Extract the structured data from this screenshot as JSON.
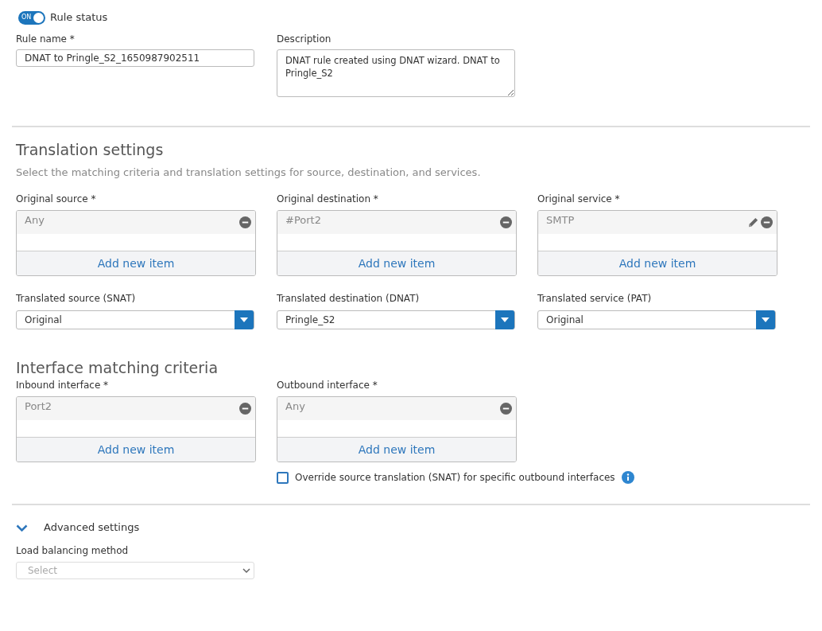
{
  "rule_status": {
    "label": "Rule status",
    "toggle_text": "ON",
    "on": true
  },
  "rule_name": {
    "label": "Rule name *",
    "value": "DNAT to Pringle_S2_1650987902511"
  },
  "description": {
    "label": "Description",
    "value": "DNAT rule created using DNAT wizard. DNAT to Pringle_S2"
  },
  "translation_settings": {
    "title": "Translation settings",
    "subtitle": "Select the matching criteria and translation settings for source, destination, and services.",
    "lists": [
      {
        "label": "Original source *",
        "items": [
          {
            "text": "Any",
            "editable": false
          }
        ],
        "add_label": "Add new item"
      },
      {
        "label": "Original destination *",
        "items": [
          {
            "text": "#Port2",
            "editable": false
          }
        ],
        "add_label": "Add new item"
      },
      {
        "label": "Original service *",
        "items": [
          {
            "text": "SMTP",
            "editable": true
          }
        ],
        "add_label": "Add new item"
      }
    ],
    "selects": [
      {
        "label": "Translated source (SNAT)",
        "value": "Original"
      },
      {
        "label": "Translated destination (DNAT)",
        "value": "Pringle_S2"
      },
      {
        "label": "Translated service (PAT)",
        "value": "Original"
      }
    ]
  },
  "interface_matching": {
    "title": "Interface matching criteria",
    "lists": [
      {
        "label": "Inbound interface *",
        "items": [
          {
            "text": "Port2",
            "editable": false
          }
        ],
        "add_label": "Add new item"
      },
      {
        "label": "Outbound interface *",
        "items": [
          {
            "text": "Any",
            "editable": false
          }
        ],
        "add_label": "Add new item"
      }
    ],
    "override": {
      "label": "Override source translation (SNAT) for specific outbound interfaces",
      "checked": false
    }
  },
  "advanced_settings": {
    "label": "Advanced settings",
    "expanded": true
  },
  "load_balancing": {
    "label": "Load balancing method",
    "placeholder": "Select",
    "disabled": true
  }
}
